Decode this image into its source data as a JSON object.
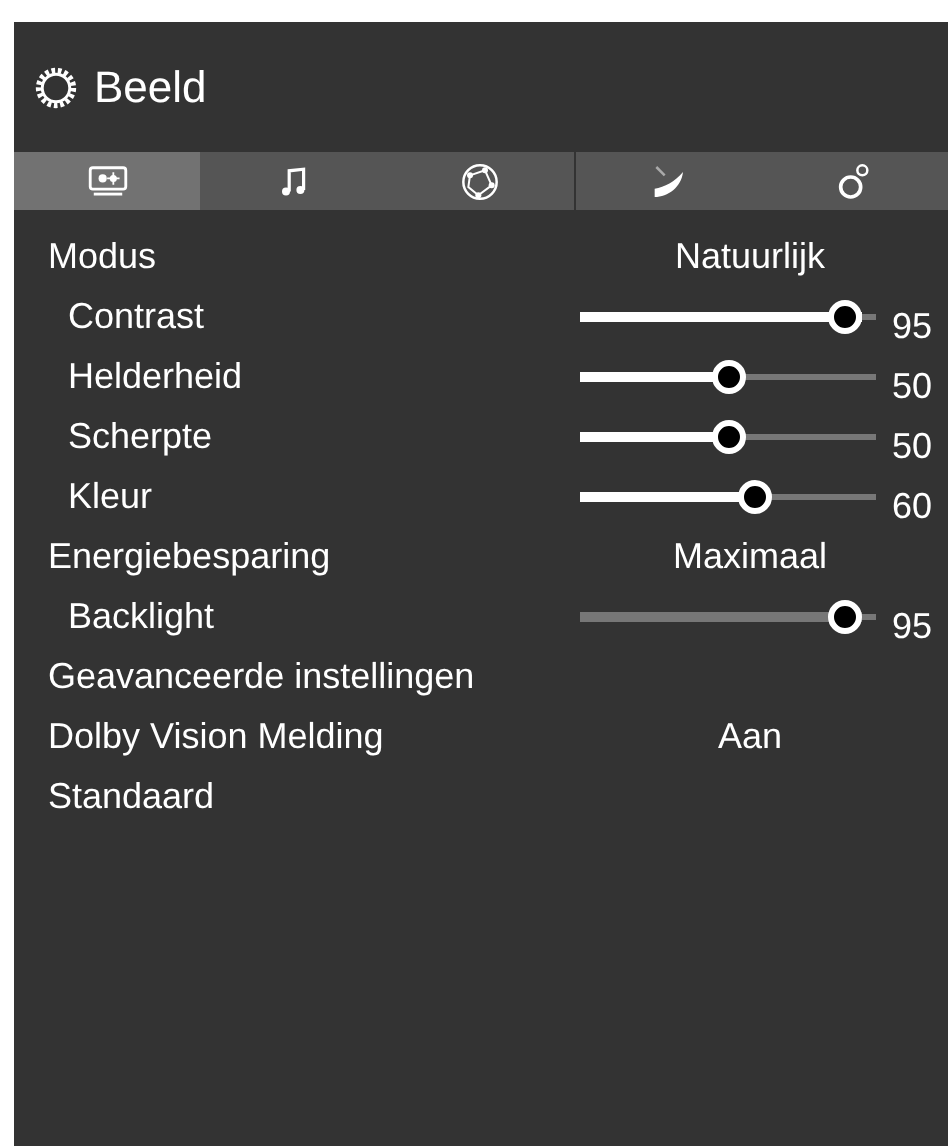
{
  "window": {
    "title": "Beeld"
  },
  "tabs": [
    {
      "kind": "picture",
      "selected": true
    },
    {
      "kind": "music",
      "selected": false
    },
    {
      "kind": "globe",
      "selected": false
    },
    {
      "kind": "dish",
      "selected": false
    },
    {
      "kind": "gears",
      "selected": false
    }
  ],
  "rows": [
    {
      "kind": "option",
      "label": "Modus",
      "value": "Natuurlijk"
    },
    {
      "kind": "slider",
      "label": "Contrast",
      "level": 0.95,
      "reading": "95",
      "disabled": false
    },
    {
      "kind": "slider",
      "label": "Helderheid",
      "level": 0.5,
      "reading": "50",
      "disabled": false
    },
    {
      "kind": "slider",
      "label": "Scherpte",
      "level": 0.5,
      "reading": "50",
      "disabled": false
    },
    {
      "kind": "slider",
      "label": "Kleur",
      "level": 0.6,
      "reading": "60",
      "disabled": false
    },
    {
      "kind": "option",
      "label": "Energiebesparing",
      "value": "Maximaal"
    },
    {
      "kind": "slider",
      "label": "Backlight",
      "level": 0.95,
      "reading": "95",
      "disabled": true
    },
    {
      "kind": "item",
      "label": "Geavanceerde instellingen"
    },
    {
      "kind": "option",
      "label": "Dolby Vision Melding",
      "value": "Aan"
    },
    {
      "kind": "item",
      "label": "Standaard"
    }
  ]
}
